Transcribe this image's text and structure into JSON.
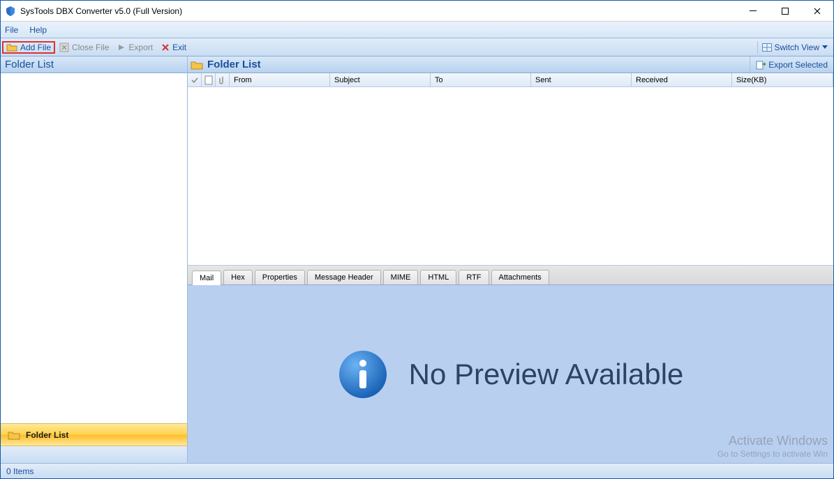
{
  "window": {
    "title": "SysTools DBX Converter v5.0 (Full Version)"
  },
  "menu": {
    "file": "File",
    "help": "Help"
  },
  "toolbar": {
    "add_file": "Add File",
    "close_file": "Close File",
    "export": "Export",
    "exit": "Exit",
    "switch_view": "Switch View"
  },
  "sidebar": {
    "header": "Folder List",
    "folder_list_btn": "Folder List"
  },
  "listpanel": {
    "header": "Folder List",
    "export_selected": "Export Selected",
    "columns": {
      "from": "From",
      "subject": "Subject",
      "to": "To",
      "sent": "Sent",
      "received": "Received",
      "size": "Size(KB)"
    }
  },
  "preview": {
    "tabs": {
      "mail": "Mail",
      "hex": "Hex",
      "properties": "Properties",
      "message_header": "Message Header",
      "mime": "MIME",
      "html": "HTML",
      "rtf": "RTF",
      "attachments": "Attachments"
    },
    "no_preview": "No Preview Available"
  },
  "watermark": {
    "line1": "Activate Windows",
    "line2": "Go to Settings to activate Win"
  },
  "status": {
    "items": "0 Items"
  }
}
